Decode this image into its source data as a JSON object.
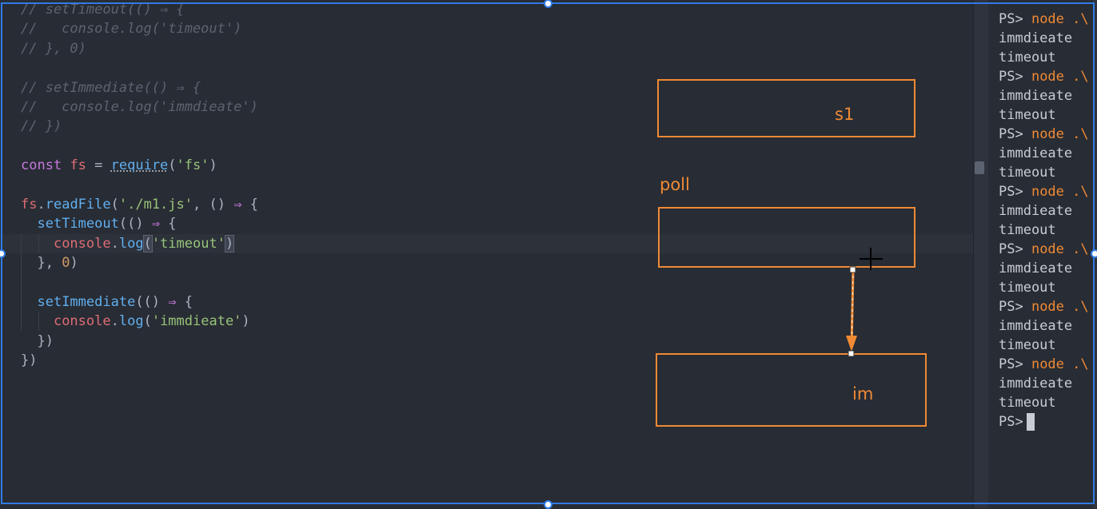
{
  "editor": {
    "lines": [
      [
        {
          "t": "// setTimeout(() ⇒ {",
          "c": "c"
        }
      ],
      [
        {
          "t": "//   console.log('timeout')",
          "c": "c"
        }
      ],
      [
        {
          "t": "// }, 0)",
          "c": "c"
        }
      ],
      [],
      [
        {
          "t": "// setImmediate(() ⇒ {",
          "c": "c"
        }
      ],
      [
        {
          "t": "//   console.log('immdieate')",
          "c": "c"
        }
      ],
      [
        {
          "t": "// })",
          "c": "c"
        }
      ],
      [],
      [
        {
          "t": "const",
          "c": "kw"
        },
        {
          "t": " ",
          "c": "pu"
        },
        {
          "t": "fs",
          "c": "vr"
        },
        {
          "t": " = ",
          "c": "pu"
        },
        {
          "t": "require",
          "c": "fn dots"
        },
        {
          "t": "(",
          "c": "pu"
        },
        {
          "t": "'fs'",
          "c": "st"
        },
        {
          "t": ")",
          "c": "pu"
        }
      ],
      [],
      [
        {
          "t": "fs",
          "c": "vr"
        },
        {
          "t": ".",
          "c": "pu"
        },
        {
          "t": "readFile",
          "c": "fn"
        },
        {
          "t": "(",
          "c": "pu"
        },
        {
          "t": "'./m1.js'",
          "c": "st"
        },
        {
          "t": ", () ",
          "c": "pu"
        },
        {
          "t": "⇒",
          "c": "ar"
        },
        {
          "t": " {",
          "c": "pu"
        }
      ],
      [
        {
          "t": "  ",
          "c": "pu"
        },
        {
          "t": "setTimeout",
          "c": "fn"
        },
        {
          "t": "(() ",
          "c": "pu"
        },
        {
          "t": "⇒",
          "c": "ar"
        },
        {
          "t": " {",
          "c": "pu"
        }
      ],
      [
        {
          "t": "    ",
          "c": "pu"
        },
        {
          "t": "console",
          "c": "vr"
        },
        {
          "t": ".",
          "c": "pu"
        },
        {
          "t": "log",
          "c": "fn"
        },
        {
          "t": "(",
          "c": "pu br-match"
        },
        {
          "t": "'timeout'",
          "c": "st"
        },
        {
          "t": ")",
          "c": "pu br-match"
        }
      ],
      [
        {
          "t": "  }, ",
          "c": "pu"
        },
        {
          "t": "0",
          "c": "nm"
        },
        {
          "t": ")",
          "c": "pu"
        }
      ],
      [],
      [
        {
          "t": "  ",
          "c": "pu"
        },
        {
          "t": "setImmediate",
          "c": "fn"
        },
        {
          "t": "(() ",
          "c": "pu"
        },
        {
          "t": "⇒",
          "c": "ar"
        },
        {
          "t": " {",
          "c": "pu"
        }
      ],
      [
        {
          "t": "    ",
          "c": "pu"
        },
        {
          "t": "console",
          "c": "vr"
        },
        {
          "t": ".",
          "c": "pu"
        },
        {
          "t": "log",
          "c": "fn"
        },
        {
          "t": "(",
          "c": "pu"
        },
        {
          "t": "'immdieate'",
          "c": "st"
        },
        {
          "t": ")",
          "c": "pu"
        }
      ],
      [
        {
          "t": "  })",
          "c": "pu"
        }
      ],
      [
        {
          "t": "})",
          "c": "pu"
        }
      ]
    ]
  },
  "diagram": {
    "s1_label": "s1",
    "poll_label": "poll",
    "im_label": "im",
    "stroke_color": "#f08a34"
  },
  "terminal": {
    "prompt": "PS>",
    "command": "node .\\",
    "runs": 7,
    "output": [
      "immdieate",
      "timeout"
    ]
  },
  "colors": {
    "editor_bg": "#282c34",
    "selection": "#2f7be5"
  }
}
